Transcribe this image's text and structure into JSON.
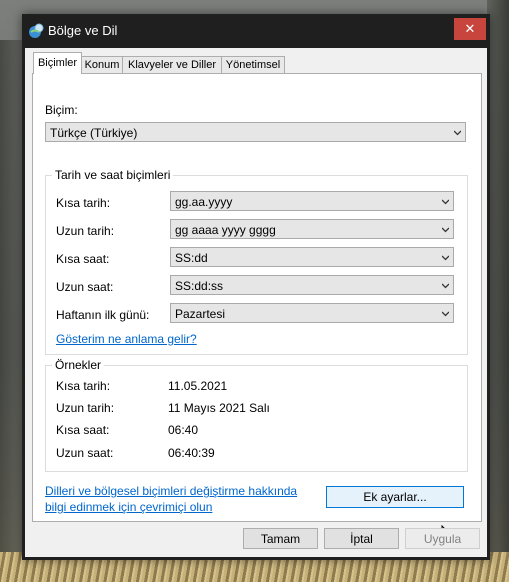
{
  "window": {
    "title": "Bölge ve Dil",
    "close_symbol": "✕"
  },
  "tabs": [
    {
      "label": "Biçimler",
      "active": true
    },
    {
      "label": "Konum",
      "active": false
    },
    {
      "label": "Klavyeler ve Diller",
      "active": false
    },
    {
      "label": "Yönetimsel",
      "active": false
    }
  ],
  "format": {
    "label": "Biçim:",
    "value": "Türkçe (Türkiye)"
  },
  "datetime_group": {
    "title": "Tarih ve saat biçimleri",
    "rows": [
      {
        "label": "Kısa tarih:",
        "value": "gg.aa.yyyy"
      },
      {
        "label": "Uzun tarih:",
        "value": "gg aaaa yyyy gggg"
      },
      {
        "label": "Kısa saat:",
        "value": "SS:dd"
      },
      {
        "label": "Uzun saat:",
        "value": "SS:dd:ss"
      },
      {
        "label": "Haftanın ilk günü:",
        "value": "Pazartesi"
      }
    ],
    "link": "Gösterim ne anlama gelir?"
  },
  "examples_group": {
    "title": "Örnekler",
    "rows": [
      {
        "label": "Kısa tarih:",
        "value": "11.05.2021"
      },
      {
        "label": "Uzun tarih:",
        "value": "11 Mayıs 2021 Salı"
      },
      {
        "label": "Kısa saat:",
        "value": "06:40"
      },
      {
        "label": "Uzun saat:",
        "value": "06:40:39"
      }
    ]
  },
  "online_link": {
    "line1": "Dilleri ve bölgesel biçimleri değiştirme hakkında",
    "line2": "bilgi edinmek için çevrimiçi olun"
  },
  "buttons": {
    "additional": "Ek ayarlar...",
    "ok": "Tamam",
    "cancel": "İptal",
    "apply": "Uygula"
  },
  "colors": {
    "titlebar": "#1f1f1f",
    "close": "#c7453c",
    "link": "#0066cc",
    "focus": "#0078d7"
  }
}
